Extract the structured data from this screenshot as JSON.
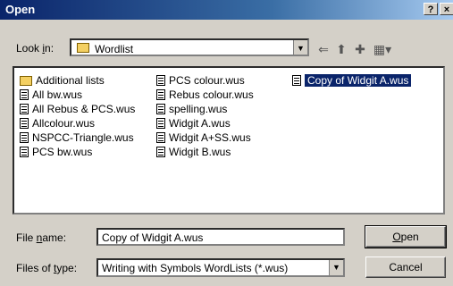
{
  "window": {
    "title": "Open",
    "help_label": "?",
    "close_label": "×"
  },
  "lookin": {
    "label_pre": "Look ",
    "label_u": "i",
    "label_post": "n:",
    "value": "Wordlist"
  },
  "toolbar": {
    "back_icon": "back-arrow-icon",
    "up_icon": "up-folder-icon",
    "new_icon": "new-folder-icon",
    "view_icon": "view-menu-icon"
  },
  "files": {
    "col1": [
      "Additional lists",
      "All bw.wus",
      "All Rebus & PCS.wus",
      "Allcolour.wus",
      "NSPCC-Triangle.wus",
      "PCS bw.wus"
    ],
    "col2": [
      "PCS colour.wus",
      "Rebus colour.wus",
      "spelling.wus",
      "Widgit A.wus",
      "Widgit A+SS.wus",
      "Widgit B.wus"
    ],
    "col3": [
      "Copy of Widgit A.wus"
    ]
  },
  "filename": {
    "label_pre": "File ",
    "label_u": "n",
    "label_post": "ame:",
    "value": "Copy of Widgit A.wus"
  },
  "filetype": {
    "label_pre": "Files of ",
    "label_u": "t",
    "label_post": "ype:",
    "value": "Writing with Symbols WordLists (*.wus)"
  },
  "buttons": {
    "open_u": "O",
    "open_rest": "pen",
    "cancel": "Cancel"
  }
}
